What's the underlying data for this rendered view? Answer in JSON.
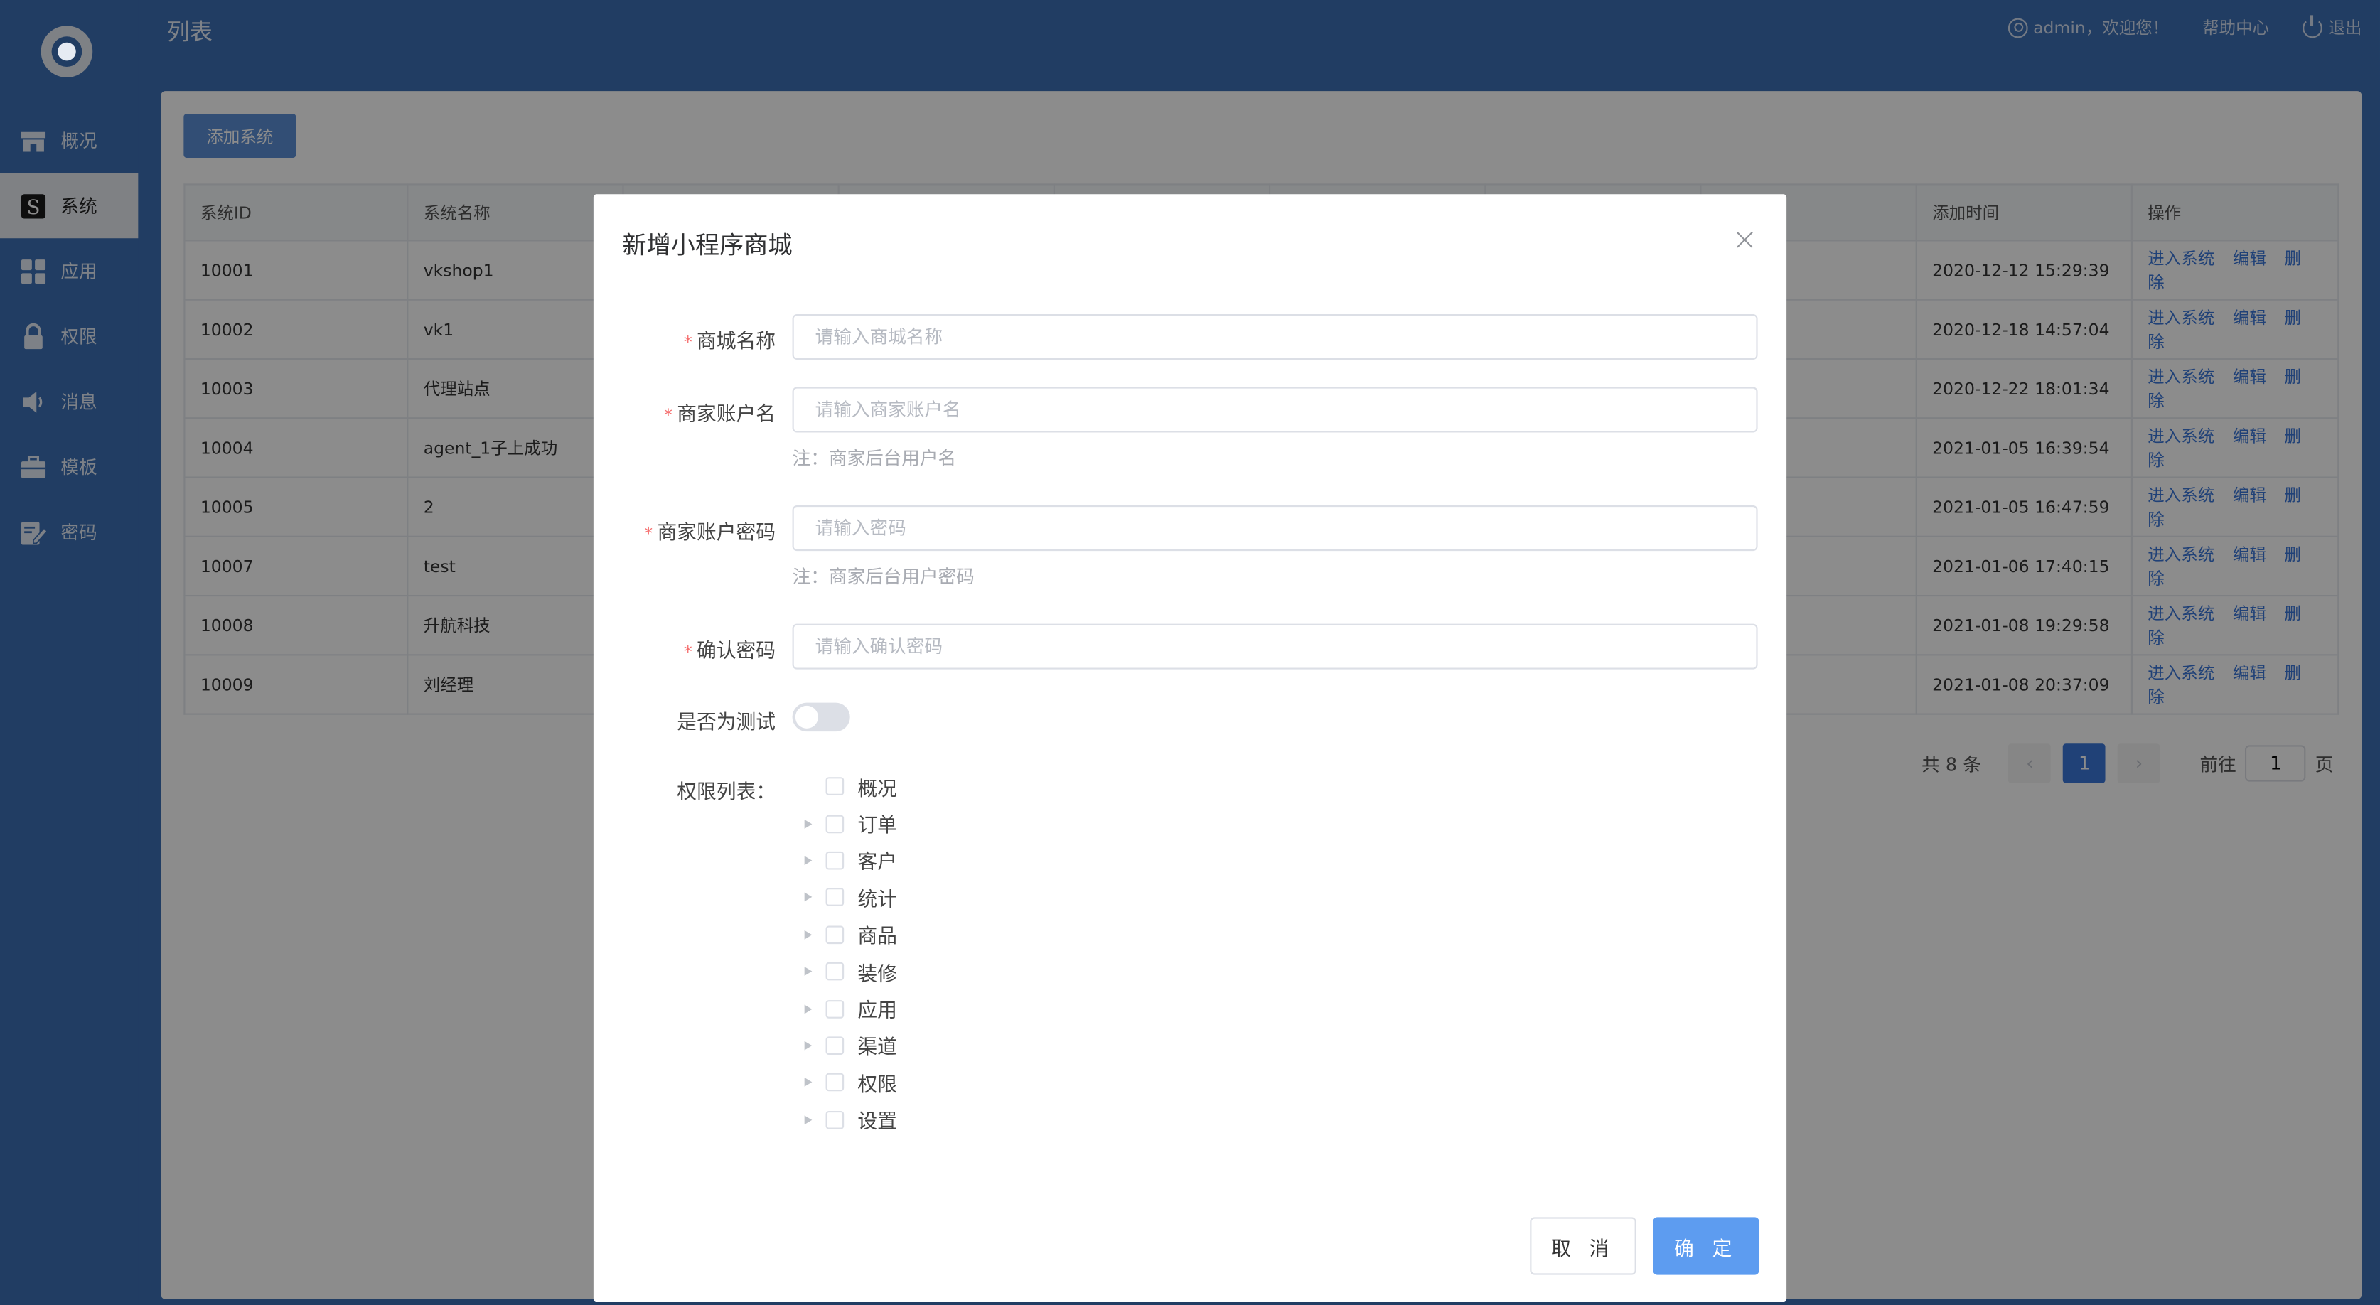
{
  "header": {
    "page_title": "列表",
    "user_greeting": "admin，欢迎您！",
    "help": "帮助中心",
    "logout": "退出"
  },
  "sidebar": {
    "items": [
      {
        "label": "概况",
        "icon": "store-icon"
      },
      {
        "label": "系统",
        "icon": "system-icon",
        "active": true
      },
      {
        "label": "应用",
        "icon": "grid-icon"
      },
      {
        "label": "权限",
        "icon": "lock-icon"
      },
      {
        "label": "消息",
        "icon": "speaker-icon"
      },
      {
        "label": "模板",
        "icon": "briefcase-icon"
      },
      {
        "label": "密码",
        "icon": "edit-icon"
      }
    ]
  },
  "toolbar": {
    "add_system": "添加系统"
  },
  "table": {
    "columns": [
      "系统ID",
      "系统名称",
      "",
      "",
      "",
      "",
      "",
      "",
      "添加时间",
      "操作"
    ],
    "rows": [
      {
        "id": "10001",
        "name": "vkshop1",
        "time": "2020-12-12 15:29:39"
      },
      {
        "id": "10002",
        "name": "vk1",
        "time": "2020-12-18 14:57:04"
      },
      {
        "id": "10003",
        "name": "代理站点",
        "time": "2020-12-22 18:01:34"
      },
      {
        "id": "10004",
        "name": "agent_1子上成功",
        "time": "2021-01-05 16:39:54"
      },
      {
        "id": "10005",
        "name": "2",
        "time": "2021-01-05 16:47:59"
      },
      {
        "id": "10007",
        "name": "test",
        "time": "2021-01-06 17:40:15"
      },
      {
        "id": "10008",
        "name": "升航科技",
        "time": "2021-01-08 19:29:58"
      },
      {
        "id": "10009",
        "name": "刘经理",
        "time": "2021-01-08 20:37:09"
      }
    ],
    "actions": {
      "enter": "进入系统",
      "edit": "编辑",
      "delete": "删除"
    }
  },
  "pager": {
    "total": "共 8 条",
    "current": "1",
    "goto": "前往",
    "goto_value": "1",
    "page_unit": "页"
  },
  "dialog": {
    "title": "新增小程序商城",
    "fields": {
      "mall_name": {
        "label": "商城名称",
        "placeholder": "请输入商城名称"
      },
      "account": {
        "label": "商家账户名",
        "placeholder": "请输入商家账户名",
        "note": "注：商家后台用户名"
      },
      "password": {
        "label": "商家账户密码",
        "placeholder": "请输入密码",
        "note": "注：商家后台用户密码"
      },
      "confirm": {
        "label": "确认密码",
        "placeholder": "请输入确认密码"
      },
      "is_test": {
        "label": "是否为测试",
        "on": false
      }
    },
    "permissions": {
      "label": "权限列表：",
      "items": [
        {
          "label": "概况",
          "expandable": false
        },
        {
          "label": "订单",
          "expandable": true
        },
        {
          "label": "客户",
          "expandable": true
        },
        {
          "label": "统计",
          "expandable": true
        },
        {
          "label": "商品",
          "expandable": true
        },
        {
          "label": "装修",
          "expandable": true
        },
        {
          "label": "应用",
          "expandable": true
        },
        {
          "label": "渠道",
          "expandable": true
        },
        {
          "label": "权限",
          "expandable": true
        },
        {
          "label": "设置",
          "expandable": true
        }
      ]
    },
    "cancel": "取 消",
    "ok": "确 定"
  },
  "colors": {
    "brand": "#3d6fb5",
    "link": "#3b77d9",
    "primary_button": "#5d9cf0",
    "required": "#f56c6c"
  }
}
